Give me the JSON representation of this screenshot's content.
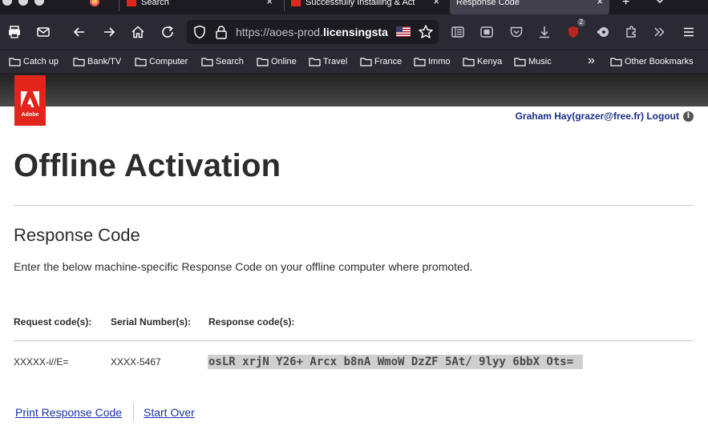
{
  "browser": {
    "tabs": [
      {
        "label": "Search",
        "active": false
      },
      {
        "label": "Successfully Installing & Act",
        "active": false
      },
      {
        "label": "Response Code",
        "active": true
      }
    ],
    "url_prefix": "https://aoes-prod.",
    "url_domain": "licensingsta",
    "extension_badge": "2",
    "bookmarks": [
      "Catch up",
      "Bank/TV",
      "Computer",
      "Search",
      "Online",
      "Travel",
      "France",
      "Immo",
      "Kenya",
      "Music"
    ],
    "other_bookmarks": "Other Bookmarks",
    "overflow_glyph": "»",
    "icons": [
      "print-icon",
      "mail-icon",
      "back-icon",
      "forward-icon",
      "home-icon",
      "reload-icon",
      "shield-icon",
      "lock-icon",
      "star-icon",
      "reader-icon",
      "screenshot-icon",
      "pocket-icon",
      "download-icon",
      "extension-icon",
      "puzzle-icon",
      "overflow-icon",
      "menu-icon"
    ]
  },
  "header": {
    "logo_text": "Adobe",
    "brand_color": "#e1251b",
    "user_label": "Graham Hay(grazer@free.fr)",
    "logout_label": "Logout",
    "info_glyph": "i"
  },
  "page": {
    "title": "Offline Activation",
    "subtitle": "Response Code",
    "description": "Enter the below machine-specific Response Code on your offline computer where promoted."
  },
  "table": {
    "headers": [
      "Request code(s):",
      "Serial Number(s):",
      "Response code(s):"
    ],
    "rows": [
      {
        "request": "XXXXX-i//E=",
        "serial": "XXXX-5467",
        "response": "osLR xrjN Y26+ Arcx b8nA WmoW DzZF 5At/ 9lyy 6bbX Ots= "
      }
    ]
  },
  "actions": {
    "print_label": "Print Response Code",
    "start_over_label": "Start Over"
  },
  "colors": {
    "link": "#1a33a8",
    "user_link": "#1a2f87"
  }
}
